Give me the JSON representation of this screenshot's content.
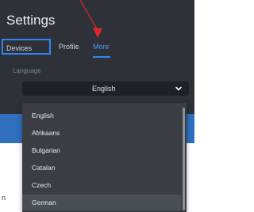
{
  "header": {
    "title": "Settings"
  },
  "tabs": [
    {
      "label": "Devices"
    },
    {
      "label": "Profile"
    },
    {
      "label": "More"
    }
  ],
  "language": {
    "label": "Language",
    "selected": "English",
    "options": [
      "English",
      "Afrikaans",
      "Bulgarian",
      "Catalan",
      "Czech",
      "German"
    ],
    "highlighted": "German"
  },
  "background": {
    "partial_text": "n"
  },
  "colors": {
    "panel": "#2e3238",
    "accent": "#2f86f6",
    "dropdown": "#3a3e44",
    "highlight": "#4a4f56",
    "annotation_arrow": "#e1262a"
  },
  "icons": [
    "chevron-down-icon",
    "annotation-arrow-icon"
  ]
}
